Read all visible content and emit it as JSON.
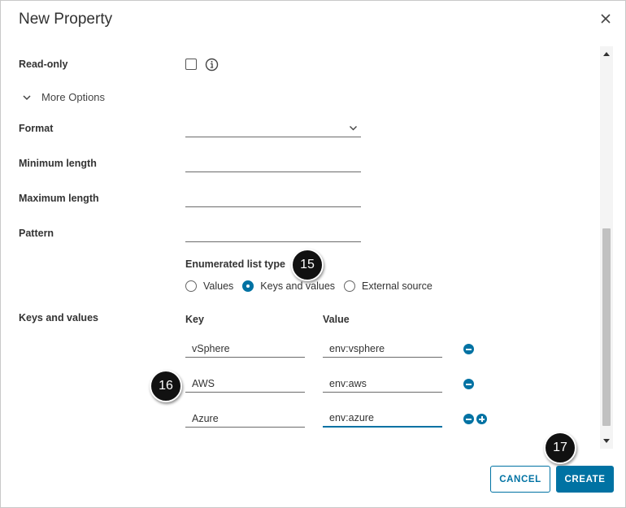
{
  "dialog": {
    "title": "New Property"
  },
  "form": {
    "read_only_label": "Read-only",
    "more_options_label": "More Options",
    "format_label": "Format",
    "min_length_label": "Minimum length",
    "max_length_label": "Maximum length",
    "pattern_label": "Pattern",
    "enum_type_label": "Enumerated list type",
    "enum_options": [
      "Values",
      "Keys and values",
      "External source"
    ],
    "enum_selected": "Keys and values",
    "keys_values_label": "Keys and values",
    "key_header": "Key",
    "value_header": "Value",
    "rows": [
      {
        "key": "vSphere",
        "value": "env:vsphere"
      },
      {
        "key": "AWS",
        "value": "env:aws"
      },
      {
        "key": "Azure",
        "value": "env:azure"
      }
    ]
  },
  "steps": [
    "15",
    "16",
    "17"
  ],
  "actions": {
    "cancel_label": "CANCEL",
    "create_label": "CREATE"
  },
  "colors": {
    "accent": "#0072a3",
    "step_badge": "#111111"
  }
}
